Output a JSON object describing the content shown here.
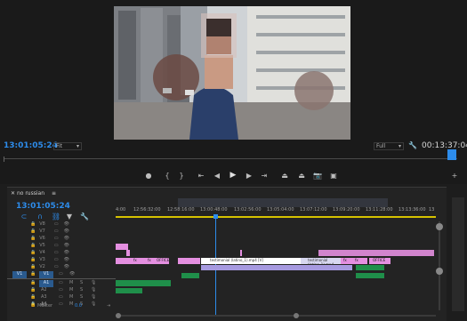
{
  "monitor": {
    "current_timecode": "13:01:05:24",
    "fit_label": "Fit",
    "quality_label": "Full",
    "duration_timecode": "00:13:37:04"
  },
  "timeline": {
    "sequence_name": "no russian",
    "current_timecode": "13:01:05:24",
    "ruler_ticks": [
      "4:00",
      "12:56:32:00",
      "12:58:16:00",
      "13:00:48:00",
      "13:02:56:00",
      "13:05:04:00",
      "13:07:12:00",
      "13:09:20:00",
      "13:11:28:00",
      "13:13:36:00",
      "13"
    ],
    "video_tracks": [
      "V8",
      "V7",
      "V6",
      "V5",
      "V4",
      "V3",
      "V2",
      "V1"
    ],
    "audio_tracks": [
      "A1",
      "A2",
      "A3",
      "A4",
      "A5"
    ],
    "source_patch_video": "V1",
    "master_label": "Master",
    "master_value": "0.0",
    "clips": {
      "testimonial_1": "testimonial (latino_1).mp4 [V]",
      "testimonial_2": "testimonial (latino_1).mp4",
      "office": "OFFICE",
      "fx": "fx",
      "mp4_label": "mp4"
    },
    "mute_label": "M",
    "solo_label": "S"
  },
  "colors": {
    "accent": "#2d8ceb",
    "clip_pink": "#e48fe0",
    "clip_purple": "#a79ae0",
    "clip_green": "#1f8f4a",
    "track_selected": "#2a5a8e"
  }
}
